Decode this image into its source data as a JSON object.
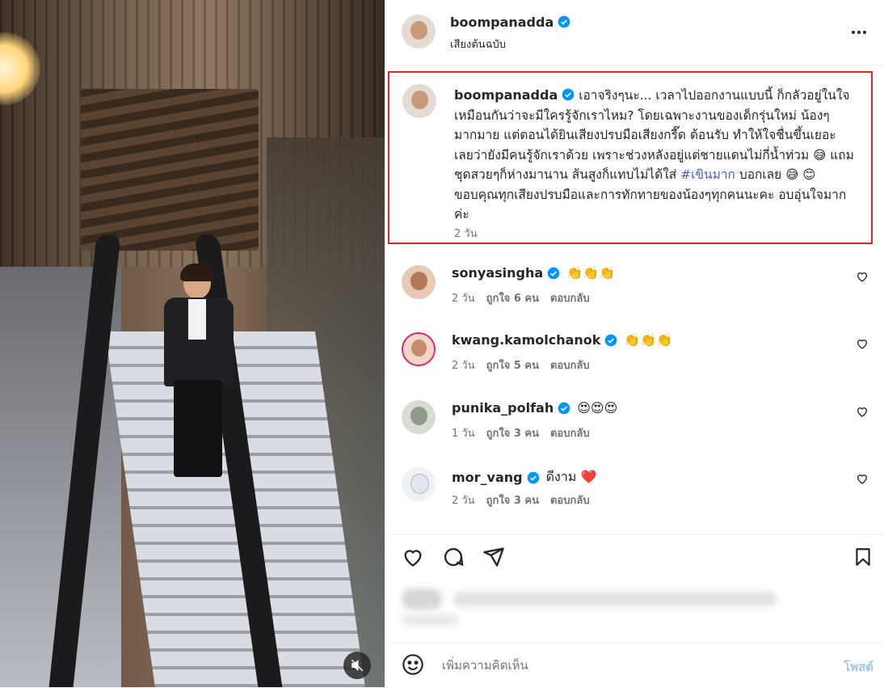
{
  "post": {
    "username": "boompanadda",
    "subtitle": "เสียงต้นฉบับ",
    "caption": {
      "username": "boompanadda",
      "text_before_hashtag": "เอาจริงๆนะ... เวลาไปออกงานแบบนี้ ก็กลัวอยู่ในใจเหมือนกันว่าจะมีใครรู้จักเราไหม? โดยเฉพาะงานของเด็กรุ่นใหม่ น้องๆมากมาย แต่ตอนได้ยินเสียงปรบมือเสียงกรี๊ด ต้อนรับ ทำให้ใจชื่นขึ้นเยอะ เลยว่ายังมีคนรู้จักเราด้วย เพราะช่วงหลังอยู่แต่ชายแดนไม่กี่น้ำท่วม 😅 แถมชุดสวยๆก็ห่างมานาน ส้นสูงก็แทบไม่ได้ใส่ ",
      "hashtag": "#เขินมาก",
      "text_after_hashtag": " บอกเลย 😅 😊 ขอบคุณทุกเสียงปรบมือและการทักทายของน้องๆทุกคนนะคะ อบอุ่นใจมากค่ะ",
      "time": "2 วัน"
    },
    "comments": [
      {
        "username": "sonyasingha",
        "text": "👏👏👏",
        "time": "2 วัน",
        "likes": "ถูกใจ 6 คน",
        "reply": "ตอบกลับ",
        "avatar_color": "#b07a5a"
      },
      {
        "username": "kwang.kamolchanok",
        "text": "👏👏👏",
        "time": "2 วัน",
        "likes": "ถูกใจ 5 คน",
        "reply": "ตอบกลับ",
        "avatar_color": "#c58c6c"
      },
      {
        "username": "punika_polfah",
        "text": "😍😍😍",
        "time": "1 วัน",
        "likes": "ถูกใจ 3 คน",
        "reply": "ตอบกลับ",
        "avatar_color": "#8f9a8a"
      },
      {
        "username": "mor_vang",
        "text": "ดีงาม ❤️",
        "time": "2 วัน",
        "likes": "ถูกใจ 3 คน",
        "reply": "ตอบกลับ",
        "avatar_color": "#dfe7f2"
      }
    ],
    "add_comment_placeholder": "เพิ่มความคิดเห็น",
    "post_button": "โพสต์"
  },
  "icons": {
    "verified": "verified-badge-icon",
    "more": "more-options-icon",
    "like": "heart-icon",
    "comment": "comment-icon",
    "share": "share-icon",
    "save": "bookmark-icon",
    "emoji": "emoji-icon",
    "mute": "mute-icon"
  },
  "colors": {
    "verified": "#0095f6",
    "highlight_border": "#d92626",
    "hashtag": "#4a5bcf",
    "post_button": "#a5c4ec"
  }
}
